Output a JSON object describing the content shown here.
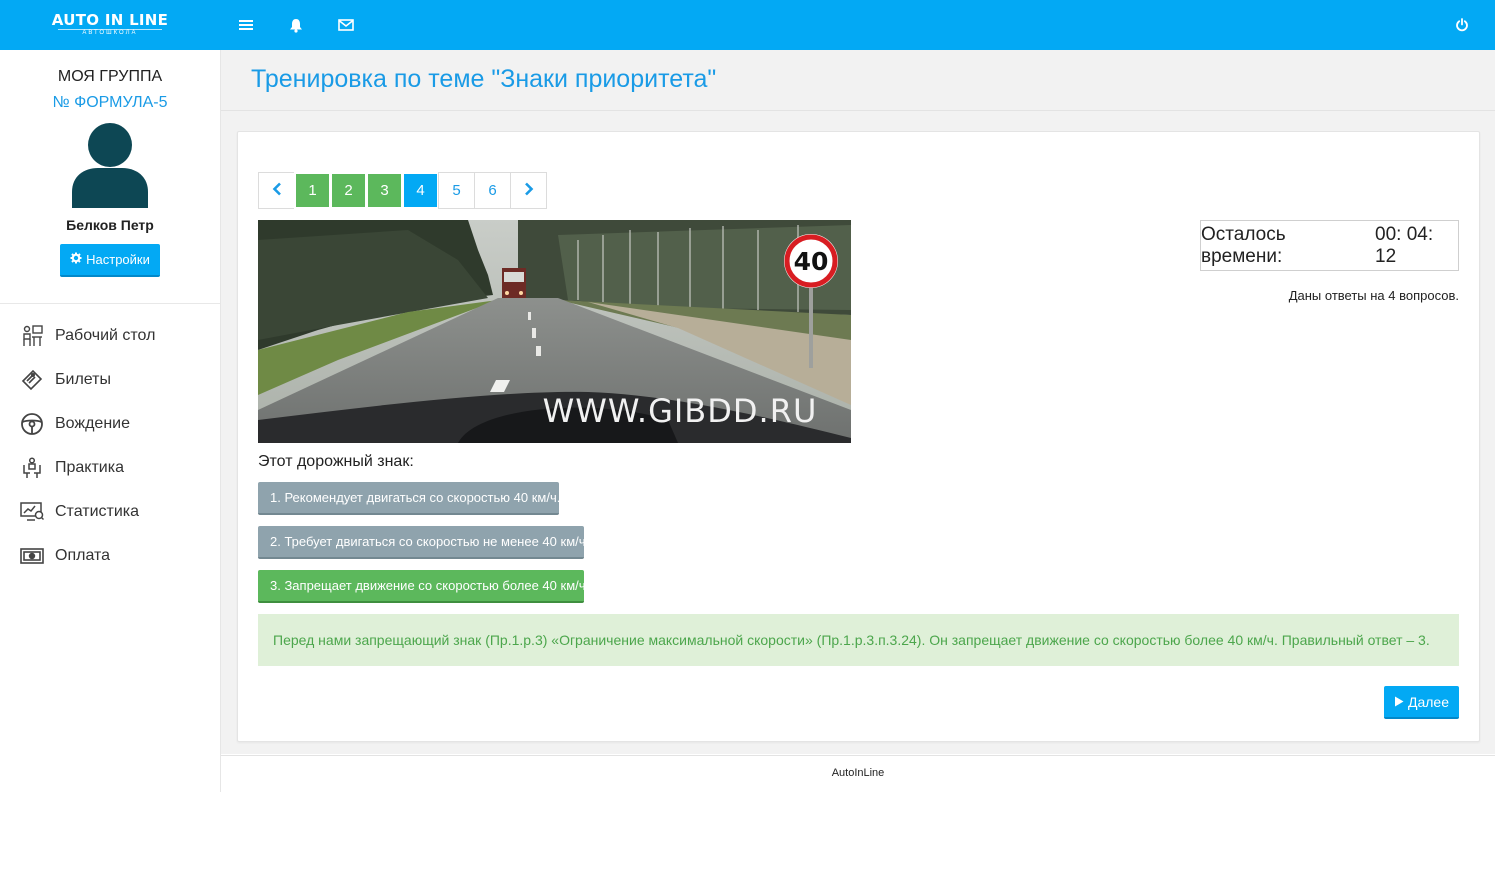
{
  "brand": {
    "name": "AUTO IN LINE",
    "subtitle": "АВТОШКОЛА"
  },
  "colors": {
    "accent": "#03a9f4",
    "success": "#5cb85c",
    "neutral_button": "#8fa3ad",
    "explanation_bg": "#dff0d8",
    "explanation_text": "#4ca64c"
  },
  "topbar": {
    "icons": [
      "menu-icon",
      "bell-icon",
      "envelope-icon",
      "power-icon"
    ]
  },
  "sidebar": {
    "group_label": "МОЯ ГРУППА",
    "group_name": "№ ФОРМУЛА-5",
    "user_name": "Белков Петр",
    "settings_label": "Настройки",
    "items": [
      {
        "label": "Рабочий стол",
        "icon": "desk-icon"
      },
      {
        "label": "Билеты",
        "icon": "ticket-icon"
      },
      {
        "label": "Вождение",
        "icon": "steering-wheel-icon"
      },
      {
        "label": "Практика",
        "icon": "practice-icon"
      },
      {
        "label": "Статистика",
        "icon": "monitor-stats-icon"
      },
      {
        "label": "Оплата",
        "icon": "money-icon"
      }
    ]
  },
  "page": {
    "title": "Тренировка по теме \"Знаки приоритета\""
  },
  "pager": {
    "prev_icon": "chevron-left-icon",
    "next_icon": "chevron-right-icon",
    "pages": [
      {
        "label": "1",
        "state": "answered"
      },
      {
        "label": "2",
        "state": "answered"
      },
      {
        "label": "3",
        "state": "answered"
      },
      {
        "label": "4",
        "state": "current"
      },
      {
        "label": "5",
        "state": "default"
      },
      {
        "label": "6",
        "state": "default"
      }
    ]
  },
  "image": {
    "sign_text": "40",
    "watermark": "WWW.GIBDD.RU"
  },
  "timer": {
    "label": "Осталось времени:",
    "value": "00: 04: 12"
  },
  "answered_count": "Даны ответы на 4 вопросов.",
  "question": {
    "text": "Этот дорожный знак:",
    "answers": [
      {
        "label": "1. Рекомендует двигаться со скоростью 40 км/ч.",
        "state": "neutral"
      },
      {
        "label": "2. Требует двигаться со скоростью не менее 40 км/ч.",
        "state": "neutral"
      },
      {
        "label": "3. Запрещает движение со скоростью более 40 км/ч.",
        "state": "correct"
      }
    ],
    "explanation": "Перед нами запрещающий знак (Пр.1.р.3) «Ограничение максимальной скорости» (Пр.1.р.3.п.3.24). Он запрещает движение со скоростью более 40 км/ч. Правильный ответ – 3."
  },
  "next_label": "Далее",
  "footer": {
    "text": "AutoInLine"
  }
}
